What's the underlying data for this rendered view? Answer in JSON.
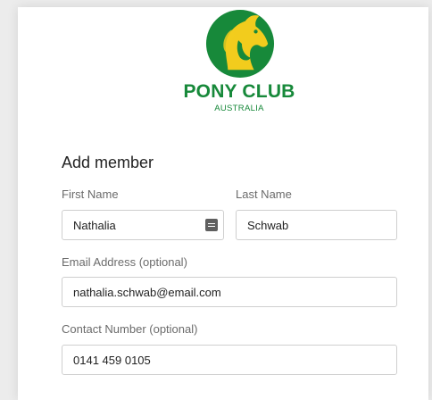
{
  "brand": {
    "title": "PONY CLUB",
    "subtitle": "AUSTRALIA",
    "colors": {
      "green": "#17893a",
      "yellow": "#f2cc1d"
    }
  },
  "form": {
    "title": "Add member",
    "first_name": {
      "label": "First Name",
      "value": "Nathalia",
      "icon": "autofill-contact-icon"
    },
    "last_name": {
      "label": "Last Name",
      "value": "Schwab"
    },
    "email": {
      "label": "Email Address (optional)",
      "value": "nathalia.schwab@email.com"
    },
    "contact_number": {
      "label": "Contact Number (optional)",
      "value": "0141 459 0105"
    }
  }
}
